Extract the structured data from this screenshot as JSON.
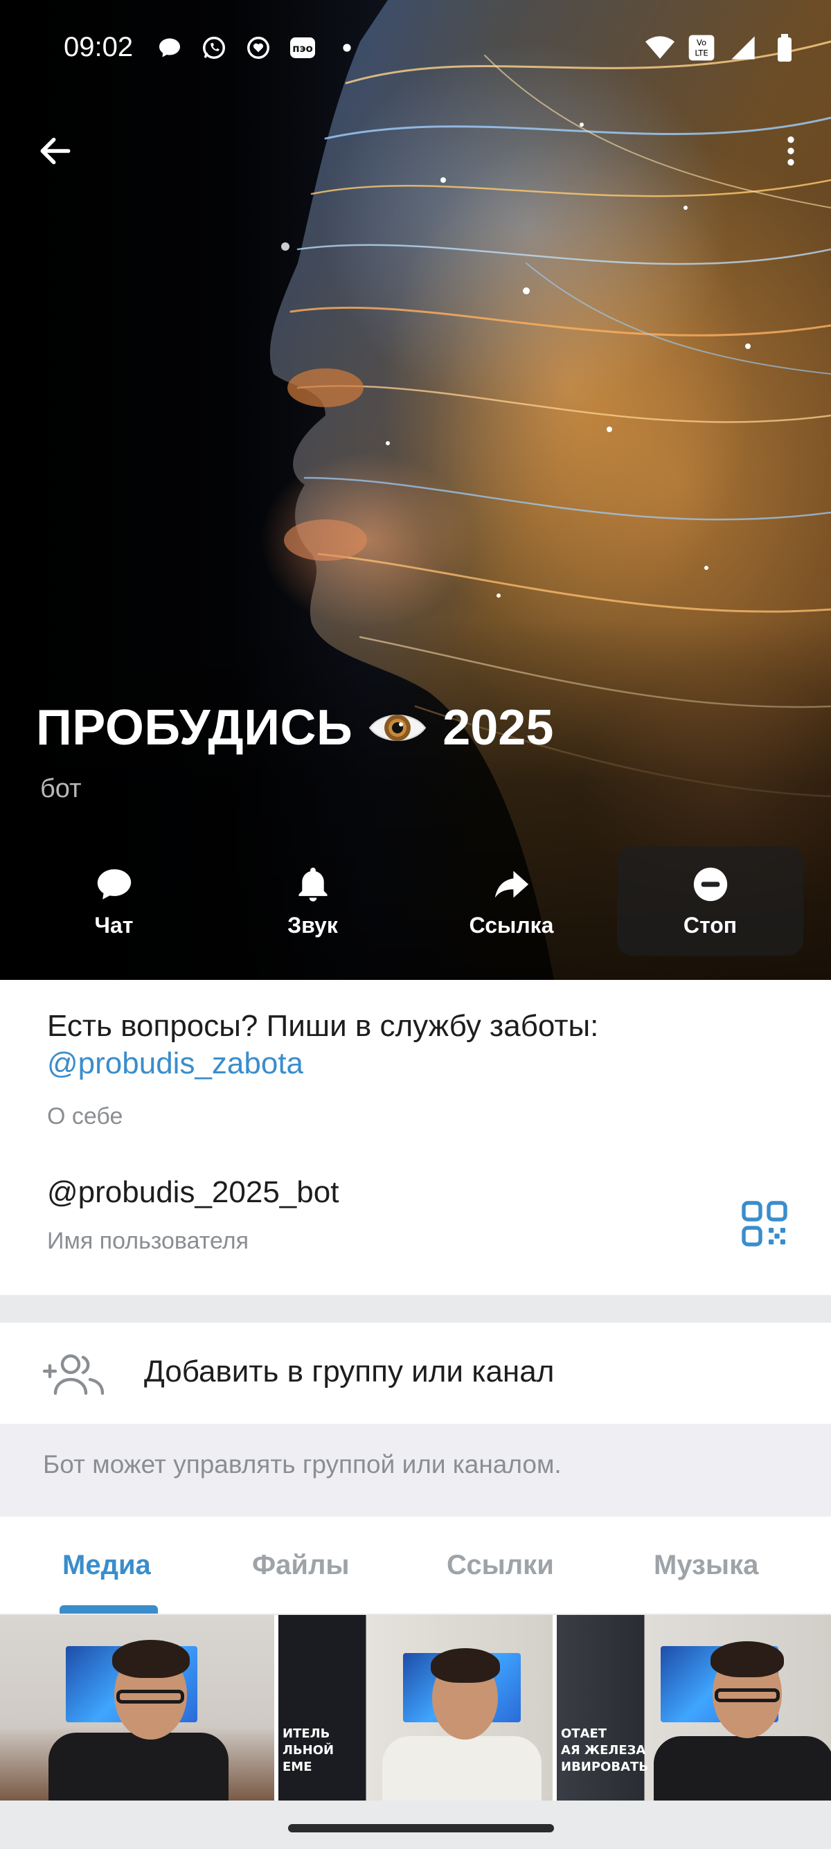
{
  "status_bar": {
    "time": "09:02",
    "left_icons": [
      "message-bubble-icon",
      "whatsapp-icon",
      "heart-chat-icon",
      "pe-app-icon",
      "dot-icon"
    ],
    "right_icons": [
      "wifi-icon",
      "volte-icon",
      "signal-icon",
      "battery-icon"
    ],
    "volte_text": "Vo LTE"
  },
  "header": {
    "back_icon": "arrow-left-icon",
    "more_icon": "more-vertical-icon",
    "title": "ПРОБУДИСЬ",
    "title_emoji": "eye-emoji",
    "title_year": "2025",
    "subtitle": "бот"
  },
  "actions": [
    {
      "label": "Чат",
      "icon": "chat-icon"
    },
    {
      "label": "Звук",
      "icon": "bell-icon"
    },
    {
      "label": "Ссылка",
      "icon": "share-icon"
    },
    {
      "label": "Стоп",
      "icon": "stop-icon"
    }
  ],
  "info": {
    "bio_text": "Есть вопросы? Пиши в службу заботы:",
    "bio_link": "@probudis_zabota",
    "bio_caption": "О себе",
    "username": "@probudis_2025_bot",
    "username_caption": "Имя пользователя",
    "qr_icon": "qr-code-icon"
  },
  "add_to_group": {
    "label": "Добавить в группу или канал",
    "icon": "add-people-icon",
    "hint": "Бот может управлять группой или каналом."
  },
  "tabs": [
    {
      "label": "Медиа",
      "active": true
    },
    {
      "label": "Файлы",
      "active": false
    },
    {
      "label": "Ссылки",
      "active": false
    },
    {
      "label": "Музыка",
      "active": false
    }
  ],
  "media": [
    {
      "overlay": []
    },
    {
      "overlay": [
        "ИТЕЛЬ",
        "ЛЬНОЙ",
        "ЕМЕ"
      ]
    },
    {
      "overlay": [
        "ОТАЕТ",
        "АЯ ЖЕЛЕЗА",
        "ИВИРОВАТЬ"
      ]
    }
  ],
  "colors": {
    "accent": "#3a8dcc",
    "text_primary": "#1d1d1f",
    "text_secondary": "#8a8e93"
  }
}
